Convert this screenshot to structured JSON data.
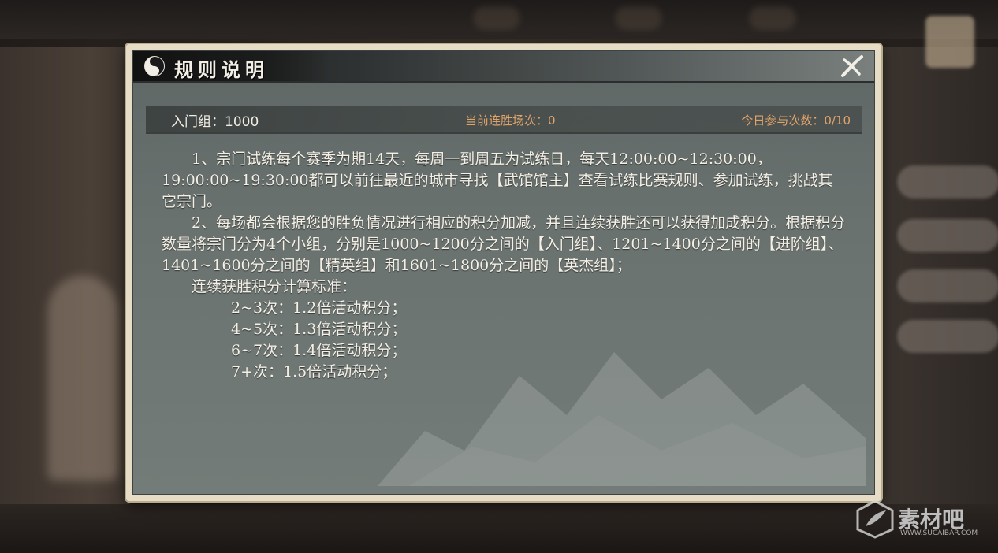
{
  "dialog": {
    "title": "规则说明"
  },
  "info": {
    "group": "入门组：1000",
    "streak": "当前连胜场次：0",
    "daily_count": "今日参与次数：0/10"
  },
  "rules": {
    "para1": "1、宗门试练每个赛季为期14天，每周一到周五为试练日，每天12:00:00~12:30:00，19:00:00~19:30:00都可以前往最近的城市寻找【武馆馆主】查看试练比赛规则、参加试练，挑战其它宗门。",
    "para2": "2、每场都会根据您的胜负情况进行相应的积分加减，并且连续获胜还可以获得加成积分。根据积分数量将宗门分为4个小组，分别是1000~1200分之间的【入门组】、1201~1400分之间的【进阶组】、1401~1600分之间的【精英组】和1601~1800分之间的【英杰组】；",
    "bonus_heading": "连续获胜积分计算标准：",
    "bonus_items": [
      "2~3次：1.2倍活动积分；",
      "4~5次：1.3倍活动积分；",
      "6~7次：1.4倍活动积分；",
      "7+次：1.5倍活动积分；"
    ]
  },
  "watermark": {
    "brand": "素材吧",
    "url": "WWW.SUCAIBAR.COM"
  },
  "colors": {
    "accent_orange": "#e3a46a",
    "text_light": "#f4f0e6",
    "panel_border": "#e7dcc5"
  }
}
